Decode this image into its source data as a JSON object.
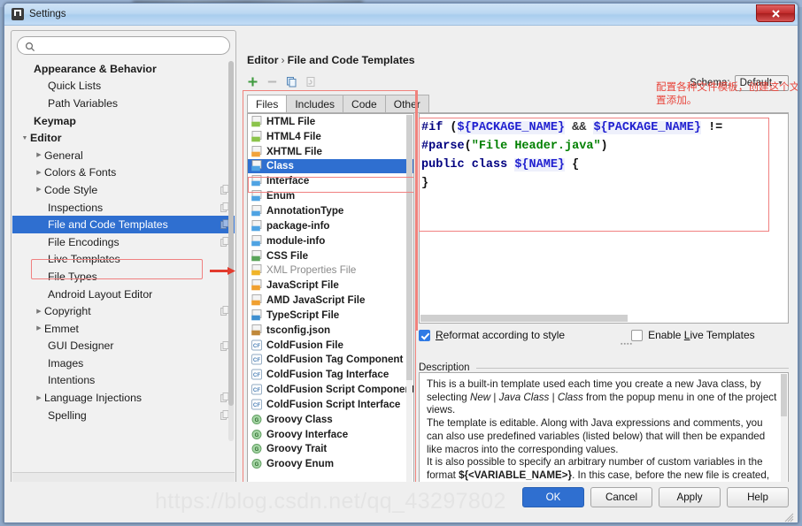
{
  "window": {
    "title": "Settings",
    "close_label": "✕"
  },
  "sidebar": {
    "search_placeholder": "",
    "search_value": "",
    "items": [
      {
        "label": "Appearance & Behavior",
        "level": 0,
        "twisty": "",
        "bold": true,
        "selected": false,
        "copy": false
      },
      {
        "label": "Quick Lists",
        "level": 1,
        "twisty": "",
        "bold": false,
        "selected": false,
        "copy": false
      },
      {
        "label": "Path Variables",
        "level": 1,
        "twisty": "",
        "bold": false,
        "selected": false,
        "copy": false
      },
      {
        "label": "Keymap",
        "level": 0,
        "twisty": "",
        "bold": true,
        "selected": false,
        "copy": false
      },
      {
        "label": "Editor",
        "level": 0,
        "twisty": "▼",
        "bold": true,
        "selected": false,
        "copy": false
      },
      {
        "label": "General",
        "level": 1,
        "twisty": "▶",
        "bold": false,
        "selected": false,
        "copy": false
      },
      {
        "label": "Colors & Fonts",
        "level": 1,
        "twisty": "▶",
        "bold": false,
        "selected": false,
        "copy": false
      },
      {
        "label": "Code Style",
        "level": 1,
        "twisty": "▶",
        "bold": false,
        "selected": false,
        "copy": true
      },
      {
        "label": "Inspections",
        "level": 1,
        "twisty": "",
        "bold": false,
        "selected": false,
        "copy": true
      },
      {
        "label": "File and Code Templates",
        "level": 1,
        "twisty": "",
        "bold": false,
        "selected": true,
        "copy": true
      },
      {
        "label": "File Encodings",
        "level": 1,
        "twisty": "",
        "bold": false,
        "selected": false,
        "copy": true
      },
      {
        "label": "Live Templates",
        "level": 1,
        "twisty": "",
        "bold": false,
        "selected": false,
        "copy": false
      },
      {
        "label": "File Types",
        "level": 1,
        "twisty": "",
        "bold": false,
        "selected": false,
        "copy": false
      },
      {
        "label": "Android Layout Editor",
        "level": 1,
        "twisty": "",
        "bold": false,
        "selected": false,
        "copy": false
      },
      {
        "label": "Copyright",
        "level": 1,
        "twisty": "▶",
        "bold": false,
        "selected": false,
        "copy": true
      },
      {
        "label": "Emmet",
        "level": 1,
        "twisty": "▶",
        "bold": false,
        "selected": false,
        "copy": false
      },
      {
        "label": "GUI Designer",
        "level": 1,
        "twisty": "",
        "bold": false,
        "selected": false,
        "copy": true
      },
      {
        "label": "Images",
        "level": 1,
        "twisty": "",
        "bold": false,
        "selected": false,
        "copy": false
      },
      {
        "label": "Intentions",
        "level": 1,
        "twisty": "",
        "bold": false,
        "selected": false,
        "copy": false
      },
      {
        "label": "Language Injections",
        "level": 1,
        "twisty": "▶",
        "bold": false,
        "selected": false,
        "copy": true
      },
      {
        "label": "Spelling",
        "level": 1,
        "twisty": "",
        "bold": false,
        "selected": false,
        "copy": true
      }
    ]
  },
  "main": {
    "breadcrumb": {
      "root": "Editor",
      "separator": "›",
      "leaf": "File and Code Templates"
    },
    "schema": {
      "label": "Schema:",
      "value": "Default"
    },
    "toolbar": [
      {
        "name": "add-template-button",
        "glyph": "+"
      },
      {
        "name": "remove-template-button",
        "glyph": "−"
      },
      {
        "name": "copy-template-button",
        "glyph": "copy"
      },
      {
        "name": "reset-template-button",
        "glyph": "reset"
      }
    ],
    "annotation": "配置各种文件模板，创建这个文件的时候，按照这里的模板生成，以及一些注解配置添加。",
    "tabs": [
      {
        "label": "Files",
        "active": true
      },
      {
        "label": "Includes",
        "active": false
      },
      {
        "label": "Code",
        "active": false
      },
      {
        "label": "Other",
        "active": false
      }
    ],
    "file_list": [
      {
        "label": "HTML File",
        "icon": "html",
        "selected": false,
        "muted": false
      },
      {
        "label": "HTML4 File",
        "icon": "html",
        "selected": false,
        "muted": false
      },
      {
        "label": "XHTML File",
        "icon": "xhtml",
        "selected": false,
        "muted": false
      },
      {
        "label": "Class",
        "icon": "java",
        "selected": true,
        "muted": false
      },
      {
        "label": "Interface",
        "icon": "java",
        "selected": false,
        "muted": false
      },
      {
        "label": "Enum",
        "icon": "java",
        "selected": false,
        "muted": false
      },
      {
        "label": "AnnotationType",
        "icon": "java",
        "selected": false,
        "muted": false
      },
      {
        "label": "package-info",
        "icon": "java",
        "selected": false,
        "muted": false
      },
      {
        "label": "module-info",
        "icon": "java",
        "selected": false,
        "muted": false
      },
      {
        "label": "CSS File",
        "icon": "css",
        "selected": false,
        "muted": false
      },
      {
        "label": "XML Properties File",
        "icon": "xml",
        "selected": false,
        "muted": true
      },
      {
        "label": "JavaScript File",
        "icon": "js",
        "selected": false,
        "muted": false
      },
      {
        "label": "AMD JavaScript File",
        "icon": "js",
        "selected": false,
        "muted": false
      },
      {
        "label": "TypeScript File",
        "icon": "ts",
        "selected": false,
        "muted": false
      },
      {
        "label": "tsconfig.json",
        "icon": "json",
        "selected": false,
        "muted": false
      },
      {
        "label": "ColdFusion File",
        "icon": "cf",
        "selected": false,
        "muted": false
      },
      {
        "label": "ColdFusion Tag Component",
        "icon": "cf",
        "selected": false,
        "muted": false
      },
      {
        "label": "ColdFusion Tag Interface",
        "icon": "cf",
        "selected": false,
        "muted": false
      },
      {
        "label": "ColdFusion Script Component",
        "icon": "cf",
        "selected": false,
        "muted": false
      },
      {
        "label": "ColdFusion Script Interface",
        "icon": "cf",
        "selected": false,
        "muted": false
      },
      {
        "label": "Groovy Class",
        "icon": "groovy",
        "selected": false,
        "muted": false
      },
      {
        "label": "Groovy Interface",
        "icon": "groovy",
        "selected": false,
        "muted": false
      },
      {
        "label": "Groovy Trait",
        "icon": "groovy",
        "selected": false,
        "muted": false
      },
      {
        "label": "Groovy Enum",
        "icon": "groovy",
        "selected": false,
        "muted": false
      }
    ],
    "editor": {
      "lines": [
        [
          {
            "t": "#if ",
            "c": "dir"
          },
          {
            "t": "(",
            "c": "pl"
          },
          {
            "t": "${PACKAGE_NAME}",
            "c": "var"
          },
          {
            "t": " && ",
            "c": "op"
          },
          {
            "t": "${PACKAGE_NAME}",
            "c": "var"
          },
          {
            "t": " !=",
            "c": "pl"
          }
        ],
        [
          {
            "t": "#parse",
            "c": "dir"
          },
          {
            "t": "(",
            "c": "pl"
          },
          {
            "t": "\"File Header.java\"",
            "c": "str"
          },
          {
            "t": ")",
            "c": "pl"
          }
        ],
        [
          {
            "t": "public class ",
            "c": "kw"
          },
          {
            "t": "${NAME}",
            "c": "var"
          },
          {
            "t": " {",
            "c": "pl"
          }
        ],
        [
          {
            "t": "}",
            "c": "pl"
          }
        ]
      ]
    },
    "options": {
      "reformat": {
        "label_pre": "R",
        "label_post": "eformat according to style",
        "checked": true
      },
      "live_templates": {
        "label_pre": "Enable ",
        "label_u": "L",
        "label_post": "ive Templates",
        "checked": false
      }
    },
    "description": {
      "label": "Description",
      "paragraphs": [
        {
          "parts": [
            {
              "t": "This is a built-in template used each time you create a new Java class, by selecting ",
              "s": "n"
            },
            {
              "t": "New",
              "s": "i"
            },
            {
              "t": " | ",
              "s": "n"
            },
            {
              "t": "Java Class",
              "s": "i"
            },
            {
              "t": " | ",
              "s": "n"
            },
            {
              "t": "Class",
              "s": "i"
            },
            {
              "t": " from the popup menu in one of the project views.",
              "s": "n"
            }
          ]
        },
        {
          "parts": [
            {
              "t": "The template is editable. Along with Java expressions and comments, you can also use predefined variables (listed below) that will then be expanded like macros into the corresponding values.",
              "s": "n"
            }
          ]
        },
        {
          "parts": [
            {
              "t": "It is also possible to specify an arbitrary number of custom variables in the format ",
              "s": "n"
            },
            {
              "t": "${<VARIABLE_NAME>}",
              "s": "b"
            },
            {
              "t": ". In this case, before the new file is created, you will be prompted with a dialog where you can define",
              "s": "n"
            }
          ]
        }
      ]
    }
  },
  "footer": {
    "buttons": [
      {
        "label": "OK",
        "primary": true
      },
      {
        "label": "Cancel",
        "primary": false
      },
      {
        "label": "Apply",
        "primary": false
      },
      {
        "label": "Help",
        "primary": false
      }
    ]
  },
  "watermark": "https://blog.csdn.net/qq_43297802",
  "colors": {
    "selection": "#2f6fd0",
    "annotation_red": "#e8463c",
    "highlight_box": "#f08080",
    "title_bar": "#bcd8f2"
  }
}
